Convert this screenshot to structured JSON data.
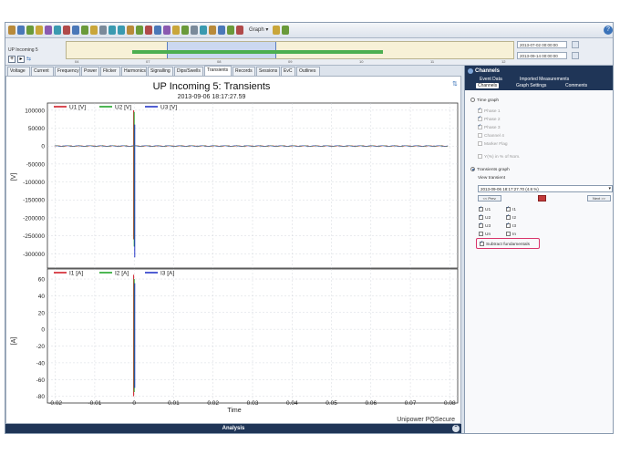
{
  "toolbar": {
    "graph_label": "Graph ▾",
    "help": "?"
  },
  "timeline": {
    "name": "UP Incoming 5",
    "date_start": "2013-07-02 00:00:00",
    "date_end": "2013-09-14 00:00:00",
    "ticks": [
      "04",
      "07",
      "08",
      "09",
      "10",
      "11",
      "12"
    ]
  },
  "tabs": [
    "Voltage",
    "Current",
    "Frequency",
    "Power",
    "Flicker",
    "Harmonics",
    "Signalling",
    "Dips/Swells",
    "Transients",
    "Records",
    "Sessions",
    "EvC",
    "Outlines"
  ],
  "active_tab": "Transients",
  "chart": {
    "title": "UP Incoming 5: Transients",
    "subtitle": "2013-09-06 18:17:27.59",
    "watermark": "Unipower PQSecure",
    "xlabel": "Time",
    "top_ylabel": "[V]",
    "bottom_ylabel": "[A]",
    "x_ticks": [
      "-0.02",
      "-0.01",
      "0",
      "0.01",
      "0.02",
      "0.03",
      "0.04",
      "0.05",
      "0.06",
      "0.07",
      "0.08"
    ],
    "top_y_ticks": [
      "100000",
      "50000",
      "0",
      "-50000",
      "-100000",
      "-150000",
      "-200000",
      "-250000",
      "-300000"
    ],
    "bottom_y_ticks": [
      "60",
      "40",
      "20",
      "0",
      "-20",
      "-40",
      "-60",
      "-80"
    ],
    "top_legend": [
      "U1 [V]",
      "U2 [V]",
      "U3 [V]"
    ],
    "bottom_legend": [
      "I1 [A]",
      "I2 [A]",
      "I3 [A]"
    ],
    "colors": {
      "phase1": "#d0202a",
      "phase2": "#22a52a",
      "phase3": "#2637c8",
      "grid": "#c9ced6"
    }
  },
  "chart_data": [
    {
      "type": "line",
      "title": "UP Incoming 5: Transients",
      "subtitle": "2013-09-06 18:17:27.59",
      "xlabel": "Time",
      "ylabel": "[V]",
      "xlim": [
        -0.022,
        0.082
      ],
      "ylim": [
        -340000,
        120000
      ],
      "series": [
        {
          "name": "U1 [V]",
          "baseline": 0,
          "amplitude": 500,
          "spike_at": 0,
          "spike_values": [
            100000,
            -260000
          ]
        },
        {
          "name": "U2 [V]",
          "baseline": 0,
          "amplitude": 500,
          "spike_at": 0,
          "spike_values": [
            95000,
            -280000
          ]
        },
        {
          "name": "U3 [V]",
          "baseline": 0,
          "amplitude": 500,
          "spike_at": 0,
          "spike_values": [
            60000,
            -310000
          ]
        }
      ],
      "frequency_hz": 50,
      "legend": "top-left",
      "grid": true
    },
    {
      "type": "line",
      "xlabel": "Time",
      "ylabel": "[A]",
      "xlim": [
        -0.022,
        0.082
      ],
      "ylim": [
        -88,
        72
      ],
      "series": [
        {
          "name": "I1 [A]",
          "amplitude": 22,
          "phase_deg": 0,
          "spike_at": 0,
          "spike_values": [
            65,
            -80
          ]
        },
        {
          "name": "I2 [A]",
          "amplitude": 22,
          "phase_deg": 120,
          "spike_at": 0,
          "spike_values": [
            60,
            -75
          ]
        },
        {
          "name": "I3 [A]",
          "amplitude": 22,
          "phase_deg": 240,
          "spike_at": 0,
          "spike_values": [
            55,
            -70
          ]
        }
      ],
      "frequency_hz": 50,
      "legend": "top-left",
      "grid": true
    }
  ],
  "analysis_bar": {
    "label": "Analysis",
    "expand": "⌃"
  },
  "right_panel": {
    "title": "Channels",
    "tab_row1": [
      "Event Data",
      "Imported Measurements"
    ],
    "tab_row2": [
      "Channels",
      "Graph Settings",
      "Comments"
    ],
    "active_tab": "Channels",
    "time_graph_label": "Time graph",
    "phase_items": [
      "Phase 1",
      "Phase 2",
      "Phase 3",
      "Channel 4",
      "Marker Flag"
    ],
    "percent_nominal": "Y(%) in % of Nom.",
    "transients_graph_label": "Transients graph",
    "view_transient_label": "View transient",
    "selected_transient": "2013-09-06 18:17:27.70 (4.8 %)",
    "prev_label": "<< Prev.",
    "next_label": "Next >>",
    "channels_left": [
      "U1",
      "U2",
      "U3",
      "Un"
    ],
    "channels_right": [
      "I1",
      "I2",
      "I3",
      "In"
    ],
    "subtract_label": "Subtract fundamentals"
  }
}
